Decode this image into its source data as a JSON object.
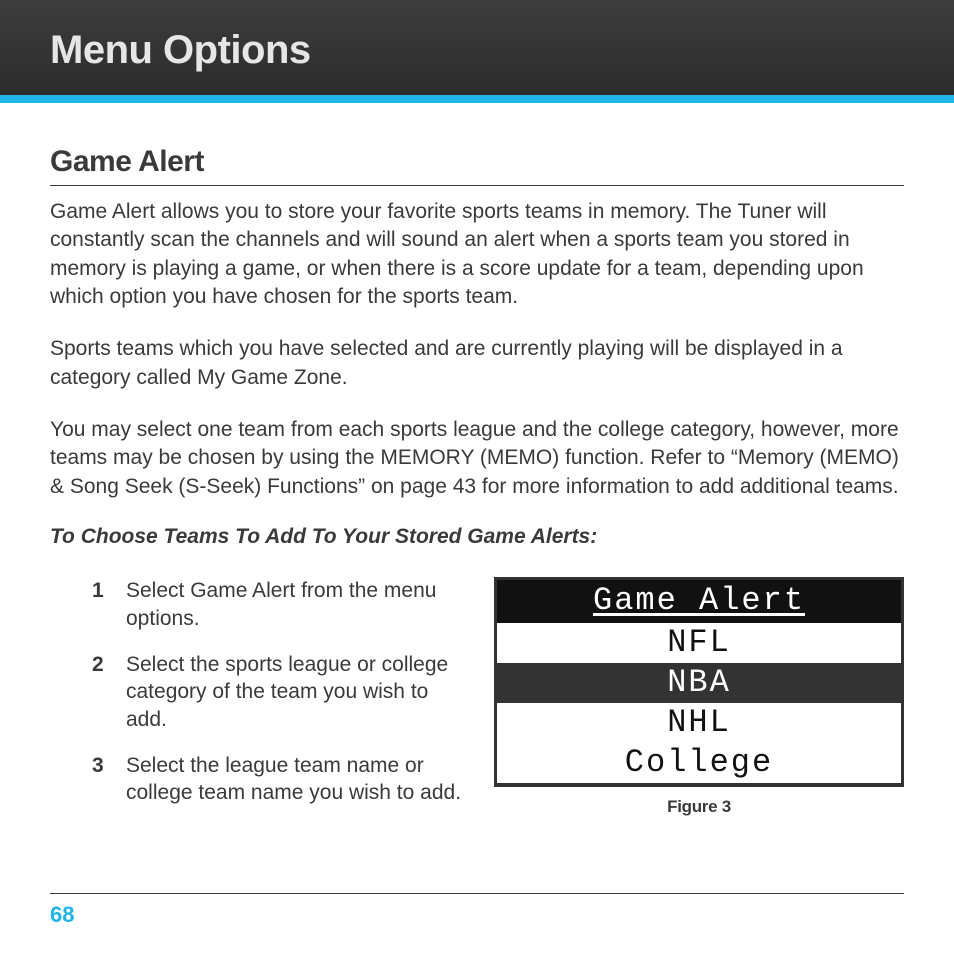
{
  "header": {
    "title": "Menu Options"
  },
  "section": {
    "title": "Game Alert",
    "p1": "Game Alert allows you to store your favorite sports teams in memory. The Tuner will constantly scan the channels and will sound an alert when a sports team you stored in memory is playing a game, or when there is a score update for a team, depending upon which option you have chosen for the sports team.",
    "p2": "Sports teams which you have selected and are currently playing will be displayed in a category called My Game Zone.",
    "p3": "You may select one team from each sports league and the college category, however, more teams may be chosen by using the MEMORY (MEMO) function. Refer to “Memory (MEMO) & Song Seek (S-Seek) Functions” on page 43 for more information to add additional teams.",
    "subhead": "To Choose Teams To Add To Your Stored Game Alerts:",
    "steps": [
      {
        "n": "1",
        "t": "Select Game Alert from the menu options."
      },
      {
        "n": "2",
        "t": "Select the sports league or college category of the team you wish to add."
      },
      {
        "n": "3",
        "t": "Select the league team name or college team name you wish to add."
      }
    ]
  },
  "device": {
    "header": "Game Alert",
    "rows": [
      {
        "label": "NFL",
        "selected": false
      },
      {
        "label": "NBA",
        "selected": true
      },
      {
        "label": "NHL",
        "selected": false
      },
      {
        "label": "College",
        "selected": false
      }
    ],
    "caption": "Figure 3"
  },
  "page": "68"
}
